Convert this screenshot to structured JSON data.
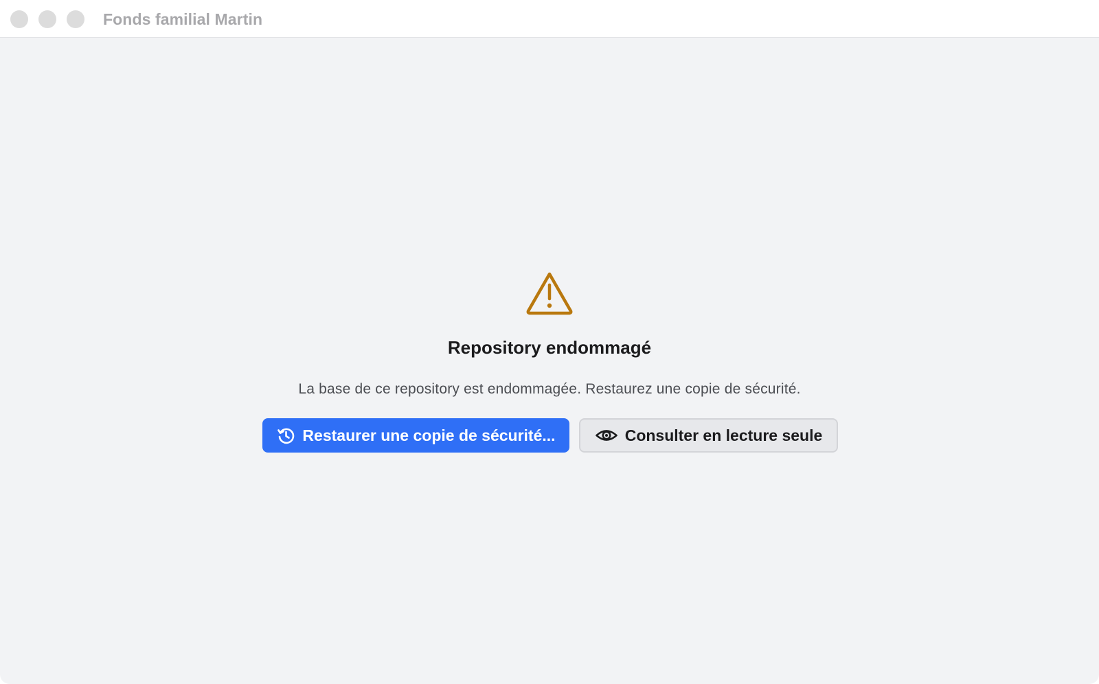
{
  "window": {
    "title": "Fonds familial Martin"
  },
  "error_state": {
    "icon": "warning-triangle-icon",
    "icon_color": "#b9780e",
    "title": "Repository endommagé",
    "message": "La base de ce repository est endommagée. Restaurez une copie de sécurité."
  },
  "actions": {
    "restore": {
      "label": "Restaurer une copie de sécurité...",
      "icon": "history-icon",
      "color": "#2f6ff6"
    },
    "readonly": {
      "label": "Consulter en lecture seule",
      "icon": "eye-icon"
    }
  }
}
